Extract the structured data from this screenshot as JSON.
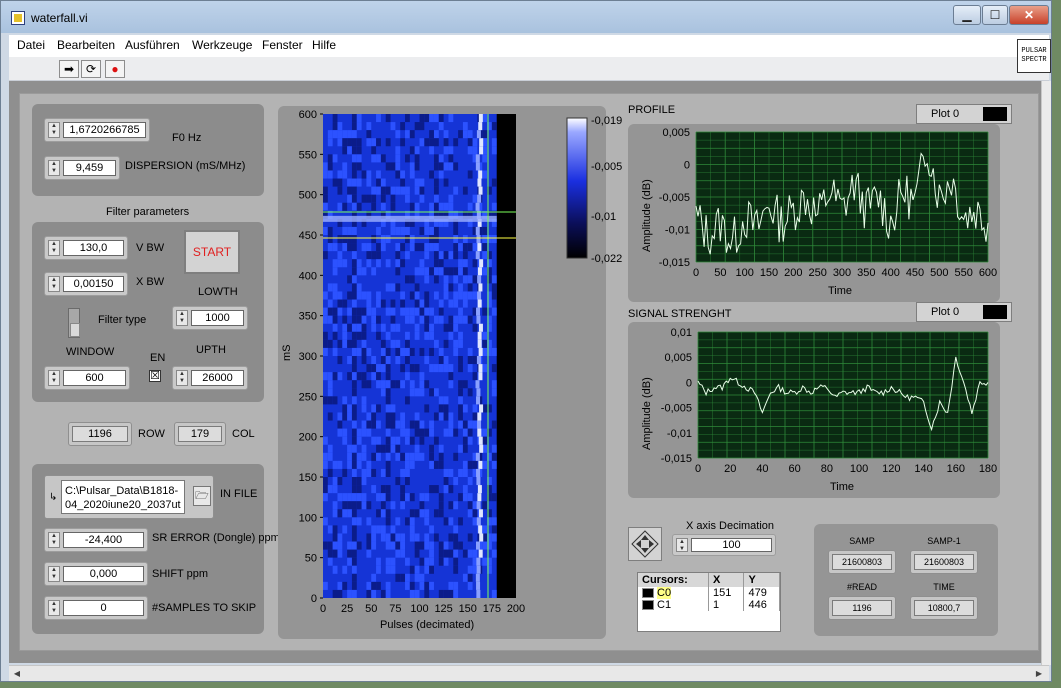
{
  "window": {
    "title": "waterfall.vi",
    "buttons": {
      "minimize": "▁",
      "maximize": "☐",
      "close": "✕"
    }
  },
  "menu": [
    "Datei",
    "Bearbeiten",
    "Ausführen",
    "Werkzeuge",
    "Fenster",
    "Hilfe"
  ],
  "toolbar": {
    "run_icon": "➡",
    "run_continuous_icon": "⟳",
    "abort_icon": "●"
  },
  "vi_icon_text": [
    "PULSAR",
    "SPECTR"
  ],
  "top_controls": {
    "f0": {
      "value": "1,6720266785",
      "label": "F0 Hz"
    },
    "dispersion": {
      "value": "9,459",
      "label": "DISPERSION (mS/MHz)"
    }
  },
  "filter": {
    "title": "Filter parameters",
    "vbw": {
      "value": "130,0",
      "label": "V BW"
    },
    "xbw": {
      "value": "0,00150",
      "label": "X BW"
    },
    "start_label": "START",
    "lowth": {
      "value": "1000",
      "label": "LOWTH"
    },
    "filter_type_label": "Filter type",
    "window": {
      "value": "600",
      "label": "WINDOW"
    },
    "en_label": "EN",
    "en_checked": "☒",
    "upth": {
      "value": "26000",
      "label": "UPTH"
    }
  },
  "rowcol": {
    "row": {
      "value": "1196",
      "label": "ROW"
    },
    "col": {
      "value": "179",
      "label": "COL"
    }
  },
  "file": {
    "path": "C:\\Pulsar_Data\\B1818-04_2020iune20_2037ut",
    "path_line1": "C:\\Pulsar_Data\\B1818-",
    "path_line2": "04_2020iune20_2037ut",
    "label": "IN FILE",
    "path_icon": "↳",
    "folder_icon": "🗁"
  },
  "params": {
    "sr_error": {
      "value": "-24,400",
      "label": "SR ERROR (Dongle) ppm"
    },
    "shift": {
      "value": "0,000",
      "label": "SHIFT ppm"
    },
    "skip": {
      "value": "0",
      "label": "#SAMPLES TO SKIP"
    }
  },
  "waterfall": {
    "ylabel": "mS",
    "xlabel": "Pulses (decimated)",
    "yticks": [
      "600",
      "550",
      "500",
      "450",
      "400",
      "350",
      "300",
      "250",
      "200",
      "150",
      "100",
      "50",
      "0"
    ],
    "xticks": [
      "0",
      "25",
      "50",
      "75",
      "100",
      "125",
      "150",
      "175",
      "200"
    ],
    "colorbar_ticks": [
      "-0,019",
      "-0,005",
      "-0,01",
      "-0,022"
    ],
    "cursor_color_c0": "#7cff5a",
    "cursor_color_c1": "#ffff44"
  },
  "profile": {
    "title": "PROFILE",
    "legend": "Plot 0",
    "ylabel": "Amplitude (dB)",
    "xlabel": "Time",
    "yticks": [
      "0,005",
      "0",
      "-0,005",
      "-0,01",
      "-0,015"
    ],
    "xticks": [
      "0",
      "50",
      "100",
      "150",
      "200",
      "250",
      "300",
      "350",
      "400",
      "450",
      "500",
      "550",
      "600"
    ]
  },
  "signal": {
    "title": "SIGNAL STRENGHT",
    "legend": "Plot 0",
    "ylabel": "Amplitude (dB)",
    "xlabel": "Time",
    "yticks": [
      "0,01",
      "0,005",
      "0",
      "-0,005",
      "-0,01",
      "-0,015"
    ],
    "xticks": [
      "0",
      "20",
      "40",
      "60",
      "80",
      "100",
      "120",
      "140",
      "160",
      "180"
    ]
  },
  "decimation": {
    "label": "X axis Decimation",
    "value": "100"
  },
  "cursors": {
    "headers": [
      "Cursors:",
      "X",
      "Y"
    ],
    "rows": [
      {
        "name": "C0",
        "x": "151",
        "y": "479"
      },
      {
        "name": "C1",
        "x": "1",
        "y": "446"
      }
    ]
  },
  "stats": {
    "samp": {
      "label": "SAMP",
      "value": "21600803"
    },
    "samp1": {
      "label": "SAMP-1",
      "value": "21600803"
    },
    "read": {
      "label": "#READ",
      "value": "1196"
    },
    "time": {
      "label": "TIME",
      "value": "10800,7"
    }
  },
  "colors": {
    "graph_bg": "#0a2a12",
    "graph_grid": "#2f8a3a",
    "trace": "#e8ffe8",
    "waterfall_base": "#1130c8",
    "start_text": "#e02020"
  },
  "chart_data": [
    {
      "type": "heatmap",
      "title": "",
      "xlabel": "Pulses (decimated)",
      "ylabel": "mS",
      "xlim": [
        0,
        200
      ],
      "ylim": [
        0,
        600
      ],
      "x": [
        0,
        25,
        50,
        75,
        100,
        125,
        150,
        175
      ],
      "y": [
        0,
        50,
        100,
        150,
        200,
        250,
        300,
        350,
        400,
        450,
        500,
        550,
        600
      ],
      "values_note": "",
      "bright_column_x": 163,
      "bright_row_y": 470,
      "colorbar": [
        -0.022,
        -0.019
      ]
    },
    {
      "type": "line",
      "title": "PROFILE",
      "xlabel": "Time",
      "ylabel": "Amplitude (dB)",
      "xlim": [
        0,
        600
      ],
      "ylim": [
        -0.015,
        0.005
      ],
      "series": [
        {
          "name": "Plot 0",
          "x": [
            0,
            25,
            50,
            75,
            100,
            125,
            150,
            175,
            200,
            225,
            250,
            275,
            300,
            325,
            350,
            375,
            400,
            425,
            450,
            475,
            500,
            525,
            550,
            575,
            600
          ],
          "y": [
            -0.008,
            -0.011,
            -0.009,
            -0.012,
            -0.008,
            -0.01,
            -0.006,
            -0.009,
            -0.007,
            -0.005,
            -0.008,
            -0.004,
            -0.007,
            -0.003,
            -0.007,
            -0.005,
            -0.009,
            -0.004,
            -0.006,
            0.003,
            -0.005,
            -0.002,
            -0.008,
            -0.007,
            -0.009
          ]
        }
      ]
    },
    {
      "type": "line",
      "title": "SIGNAL STRENGHT",
      "xlabel": "Time",
      "ylabel": "Amplitude (dB)",
      "xlim": [
        0,
        180
      ],
      "ylim": [
        -0.015,
        0.01
      ],
      "series": [
        {
          "name": "Plot 0",
          "x": [
            0,
            5,
            10,
            15,
            20,
            25,
            30,
            35,
            40,
            45,
            50,
            55,
            60,
            65,
            70,
            75,
            80,
            85,
            90,
            95,
            100,
            105,
            110,
            115,
            120,
            125,
            130,
            135,
            140,
            145,
            150,
            155,
            160,
            165,
            170,
            175,
            180
          ],
          "y": [
            0,
            -0.002,
            -0.001,
            -0.001,
            0.001,
            0,
            -0.001,
            -0.002,
            -0.006,
            -0.002,
            -0.001,
            -0.002,
            -0.002,
            -0.001,
            -0.002,
            -0.001,
            -0.001,
            -0.003,
            -0.002,
            -0.002,
            -0.002,
            -0.001,
            -0.002,
            -0.002,
            -0.001,
            -0.002,
            -0.003,
            -0.003,
            -0.004,
            -0.009,
            -0.004,
            -0.006,
            0.005,
            0.0,
            -0.006,
            0.0,
            0.0
          ]
        }
      ]
    }
  ]
}
